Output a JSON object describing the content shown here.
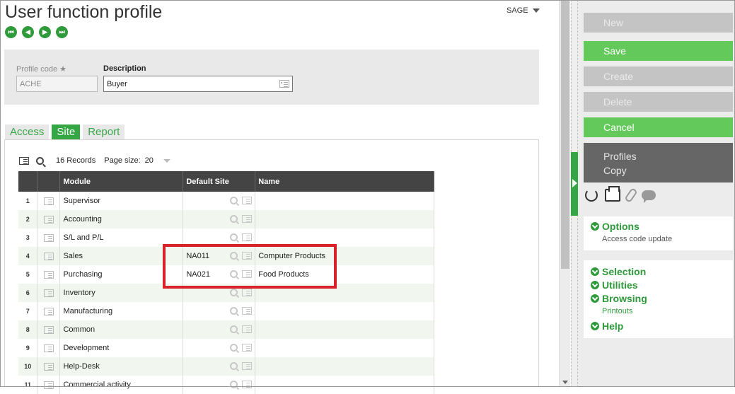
{
  "page": {
    "title": "User function profile",
    "sage_label": "SAGE"
  },
  "header_fields": {
    "profile_code_label": "Profile code ★",
    "profile_code_value": "ACHE",
    "description_label": "Description",
    "description_value": "Buyer"
  },
  "tabs": [
    {
      "label": "Access",
      "active": false
    },
    {
      "label": "Site",
      "active": true
    },
    {
      "label": "Report",
      "active": false
    }
  ],
  "grid": {
    "records_text": "16 Records",
    "page_size_label": "Page size:",
    "page_size_value": "20",
    "columns": [
      "Module",
      "Default Site",
      "Name"
    ],
    "rows": [
      {
        "num": "1",
        "module": "Supervisor",
        "site": "",
        "name": ""
      },
      {
        "num": "2",
        "module": "Accounting",
        "site": "",
        "name": ""
      },
      {
        "num": "3",
        "module": "S/L and P/L",
        "site": "",
        "name": ""
      },
      {
        "num": "4",
        "module": "Sales",
        "site": "NA011",
        "name": "Computer Products"
      },
      {
        "num": "5",
        "module": "Purchasing",
        "site": "NA021",
        "name": "Food Products"
      },
      {
        "num": "6",
        "module": "Inventory",
        "site": "",
        "name": ""
      },
      {
        "num": "7",
        "module": "Manufacturing",
        "site": "",
        "name": ""
      },
      {
        "num": "8",
        "module": "Common",
        "site": "",
        "name": ""
      },
      {
        "num": "9",
        "module": "Development",
        "site": "",
        "name": ""
      },
      {
        "num": "10",
        "module": "Help-Desk",
        "site": "",
        "name": ""
      },
      {
        "num": "11",
        "module": "Commercial activity",
        "site": "",
        "name": ""
      }
    ]
  },
  "actions": {
    "new": "New",
    "save": "Save",
    "create": "Create",
    "delete": "Delete",
    "cancel": "Cancel",
    "profiles_copy_line1": "Profiles",
    "profiles_copy_line2": "Copy"
  },
  "side_menu": {
    "options": "Options",
    "access_code_update": "Access code update",
    "selection": "Selection",
    "utilities": "Utilities",
    "browsing": "Browsing",
    "printouts": "Printouts",
    "help": "Help"
  },
  "colors": {
    "accent_green": "#34a644",
    "highlight_red": "#d8232a"
  }
}
